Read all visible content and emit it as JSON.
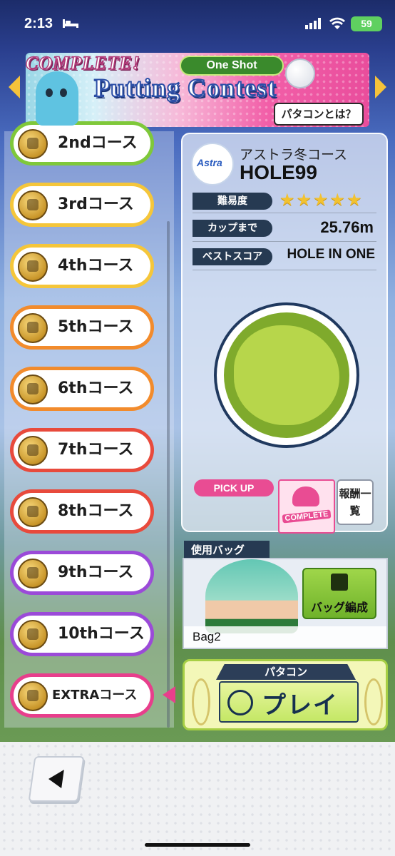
{
  "status_bar": {
    "time": "2:13",
    "battery": "59"
  },
  "banner": {
    "complete": "COMPLETE!",
    "tag": "One Shot",
    "title": "Putting Contest",
    "help_button": "パタコンとは？"
  },
  "courses": [
    {
      "label": "2ndコース",
      "color": "#7fc83a"
    },
    {
      "label": "3rdコース",
      "color": "#f5c63a"
    },
    {
      "label": "4thコース",
      "color": "#f5c63a"
    },
    {
      "label": "5thコース",
      "color": "#f28b2c"
    },
    {
      "label": "6thコース",
      "color": "#f28b2c"
    },
    {
      "label": "7thコース",
      "color": "#e84a3c"
    },
    {
      "label": "8thコース",
      "color": "#e84a3c"
    },
    {
      "label": "9thコース",
      "color": "#9b4ad8"
    },
    {
      "label": "10thコース",
      "color": "#9b4ad8"
    },
    {
      "label": "EXTRAコース",
      "color": "#e83e8c"
    }
  ],
  "course_info": {
    "logo_text": "Astra",
    "course_name": "アストラ冬コース",
    "hole": "HOLE99",
    "difficulty_label": "難易度",
    "difficulty_stars": "★★★★★",
    "to_cup_label": "カップまで",
    "to_cup_value": "25.76m",
    "best_score_label": "ベストスコア",
    "best_score_value": "HOLE IN ONE",
    "pickup_label": "PICK UP",
    "complete_badge": "COMPLETE",
    "rewards_button": "報酬一覧"
  },
  "bag": {
    "tab_label": "使用バッグ",
    "bag_name": "Bag2",
    "edit_button": "バッグ編成"
  },
  "play": {
    "header": "パタコン",
    "label": "プレイ"
  }
}
